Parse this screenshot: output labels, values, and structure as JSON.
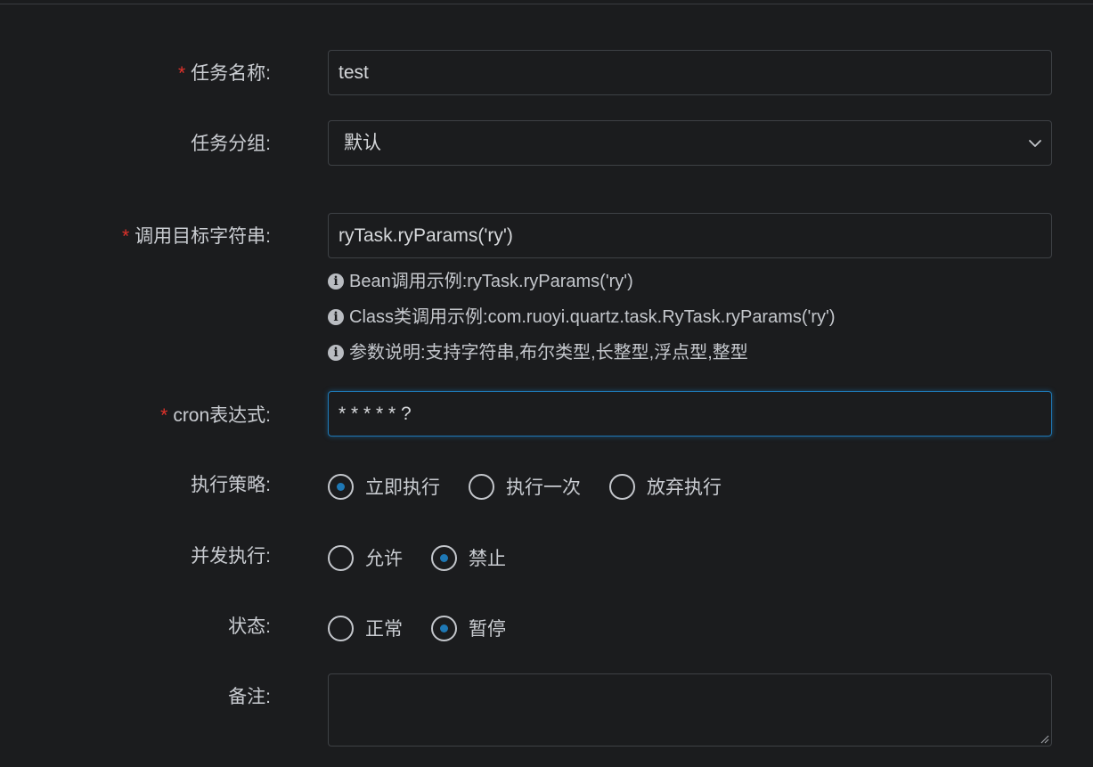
{
  "form": {
    "task_name": {
      "label": "任务名称:",
      "required": "*",
      "value": "test"
    },
    "task_group": {
      "label": "任务分组:",
      "selected": "默认",
      "icon": "chevron-down-icon"
    },
    "invoke_target": {
      "label": "调用目标字符串:",
      "required": "*",
      "value": "ryTask.ryParams('ry')",
      "help": [
        "Bean调用示例:ryTask.ryParams('ry')",
        "Class类调用示例:com.ruoyi.quartz.task.RyTask.ryParams('ry')",
        "参数说明:支持字符串,布尔类型,长整型,浮点型,整型"
      ]
    },
    "cron": {
      "label": "cron表达式:",
      "required": "*",
      "value": "* * * * * ?"
    },
    "misfire_policy": {
      "label": "执行策略:",
      "options": [
        "立即执行",
        "执行一次",
        "放弃执行"
      ],
      "selected_index": 0
    },
    "concurrent": {
      "label": "并发执行:",
      "options": [
        "允许",
        "禁止"
      ],
      "selected_index": 1
    },
    "status": {
      "label": "状态:",
      "options": [
        "正常",
        "暂停"
      ],
      "selected_index": 1
    },
    "remark": {
      "label": "备注:",
      "value": ""
    }
  },
  "colors": {
    "background": "#1b1c1e",
    "required": "#e0322b",
    "accent": "#1e78b5",
    "border": "#3e4145"
  }
}
